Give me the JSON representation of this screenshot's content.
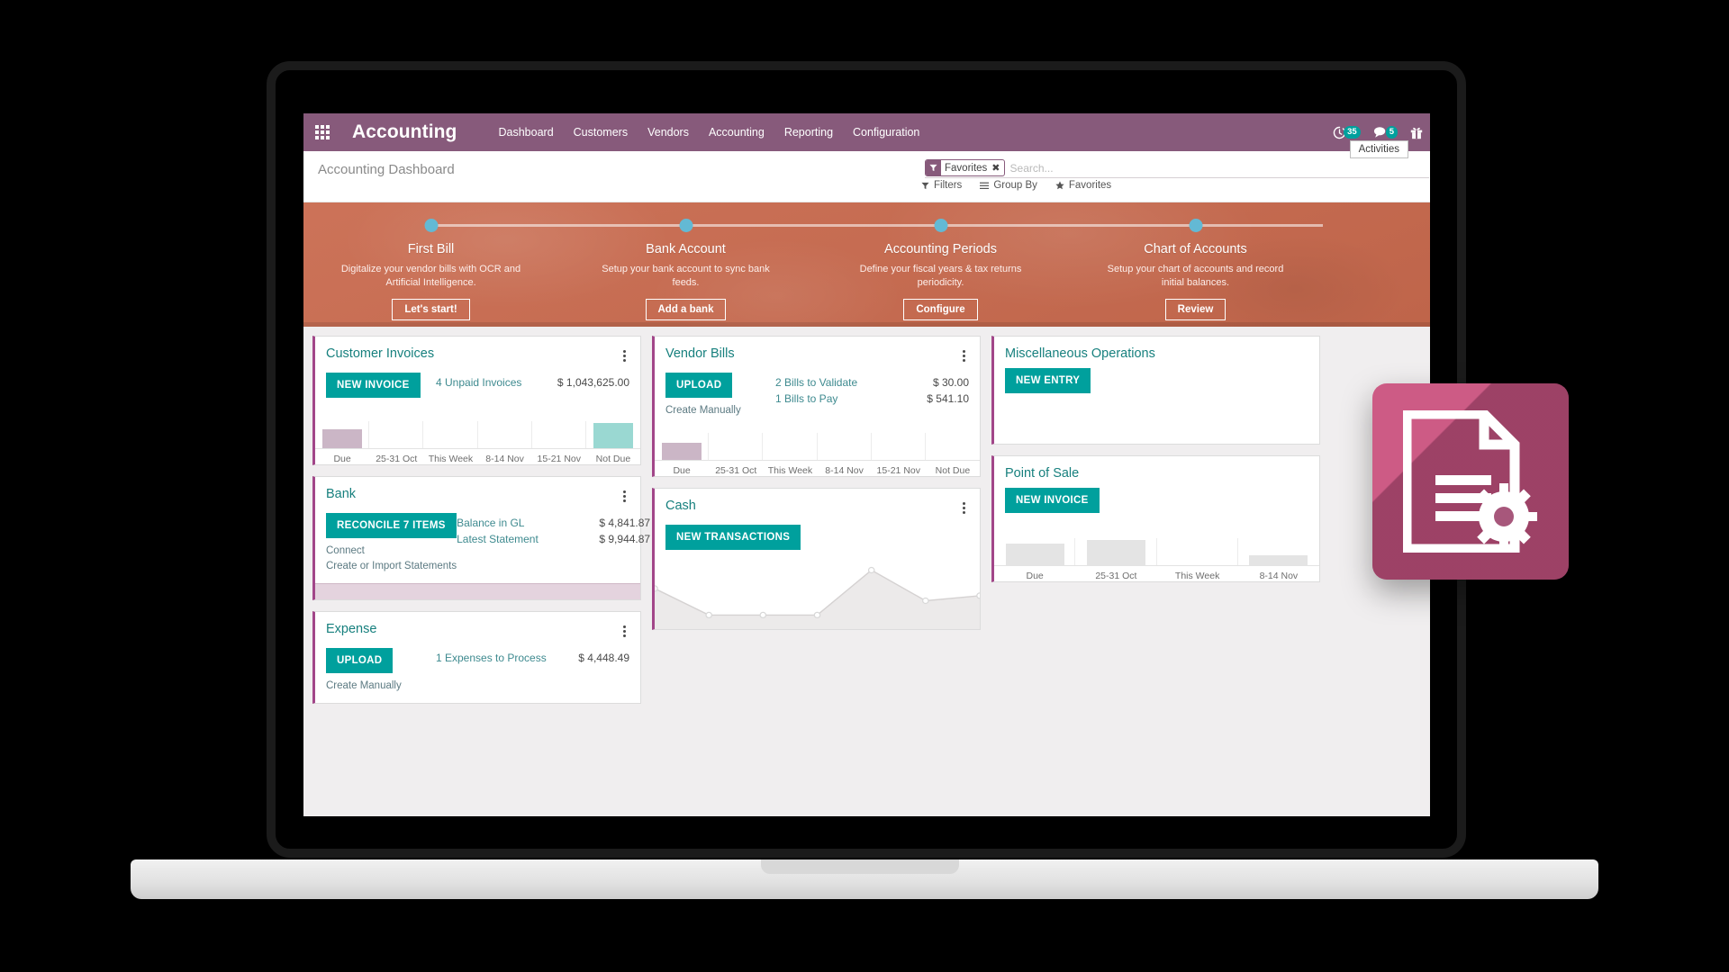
{
  "app": {
    "name": "Accounting",
    "apps_icon": "apps-grid-icon"
  },
  "navbar": {
    "menu_items": [
      {
        "label": "Dashboard"
      },
      {
        "label": "Customers"
      },
      {
        "label": "Vendors"
      },
      {
        "label": "Accounting"
      },
      {
        "label": "Reporting"
      },
      {
        "label": "Configuration"
      }
    ],
    "activities": {
      "icon": "clock-activities-icon",
      "badge": "35"
    },
    "messages": {
      "icon": "chat-messages-icon",
      "badge": "5"
    },
    "gift": {
      "icon": "gift-icon"
    },
    "tooltip": "Activities"
  },
  "control_panel": {
    "title": "Accounting Dashboard",
    "facet": {
      "icon": "filter-funnel-icon",
      "label": "Favorites",
      "remove": "✖"
    },
    "search_placeholder": "Search...",
    "search_value": "",
    "buttons": [
      {
        "label": "Filters",
        "icon": "funnel-icon"
      },
      {
        "label": "Group By",
        "icon": "list-icon"
      },
      {
        "label": "Favorites",
        "icon": "star-icon"
      }
    ]
  },
  "onboarding": {
    "accent": "#c96a4e",
    "dot_color": "#63b9d4",
    "steps": [
      {
        "title": "First Bill",
        "desc": "Digitalize your vendor bills with OCR and Artificial Intelligence.",
        "button": "Let's start!"
      },
      {
        "title": "Bank Account",
        "desc": "Setup your bank account to sync bank feeds.",
        "button": "Add a bank"
      },
      {
        "title": "Accounting Periods",
        "desc": "Define your fiscal years & tax returns periodicity.",
        "button": "Configure"
      },
      {
        "title": "Chart of Accounts",
        "desc": "Setup your chart of accounts and record initial balances.",
        "button": "Review"
      }
    ]
  },
  "dashboard": {
    "accent_teal": "#00a09d",
    "accent_purple": "#a24689",
    "customer_invoices": {
      "title": "Customer Invoices",
      "primary_button": "NEW INVOICE",
      "stats": [
        {
          "label": "4 Unpaid Invoices",
          "value": "$ 1,043,625.00"
        }
      ],
      "chart_data": {
        "type": "bar",
        "title": "Customer Invoices aging",
        "categories": [
          "Due",
          "25-31 Oct",
          "This Week",
          "8-14 Nov",
          "15-21 Nov",
          "Not Due"
        ],
        "values": [
          22,
          0,
          0,
          0,
          0,
          30
        ],
        "colors": [
          "#cbb6c6",
          "#cbb6c6",
          "#cbb6c6",
          "#cbb6c6",
          "#cbb6c6",
          "#9ad8d2"
        ],
        "xlabel": "",
        "ylabel": "",
        "ylim": [
          0,
          36
        ],
        "grid": true,
        "legend": "none"
      }
    },
    "vendor_bills": {
      "title": "Vendor Bills",
      "primary_button": "UPLOAD",
      "secondary_link": "Create Manually",
      "stats": [
        {
          "label": "2 Bills to Validate",
          "value": "$ 30.00"
        },
        {
          "label": "1 Bills to Pay",
          "value": "$ 541.10"
        }
      ],
      "chart_data": {
        "type": "bar",
        "title": "Vendor Bills aging",
        "categories": [
          "Due",
          "25-31 Oct",
          "This Week",
          "8-14 Nov",
          "15-21 Nov",
          "Not Due"
        ],
        "values": [
          20,
          0,
          0,
          0,
          0,
          0
        ],
        "colors": [
          "#cbb6c6",
          "#cbb6c6",
          "#cbb6c6",
          "#cbb6c6",
          "#cbb6c6",
          "#cbb6c6"
        ],
        "xlabel": "",
        "ylabel": "",
        "ylim": [
          0,
          36
        ],
        "grid": true,
        "legend": "none"
      }
    },
    "misc_operations": {
      "title": "Miscellaneous Operations",
      "primary_button": "NEW ENTRY"
    },
    "bank": {
      "title": "Bank",
      "primary_button": "RECONCILE 7 ITEMS",
      "links": [
        "Connect",
        "Create or Import Statements"
      ],
      "stats": [
        {
          "label": "Balance in GL",
          "value": "$ 4,841.87"
        },
        {
          "label": "Latest Statement",
          "value": "$ 9,944.87"
        }
      ]
    },
    "cash": {
      "title": "Cash",
      "primary_button": "NEW TRANSACTIONS",
      "chart_data": {
        "type": "area",
        "title": "Cash balance trend",
        "x": [
          0,
          1,
          2,
          3,
          4,
          5,
          6
        ],
        "values": [
          38,
          12,
          12,
          12,
          56,
          26,
          31
        ],
        "xlabel": "",
        "ylabel": "",
        "ylim": [
          0,
          60
        ],
        "grid": false,
        "legend": "none"
      }
    },
    "point_of_sale": {
      "title": "Point of Sale",
      "primary_button": "NEW INVOICE",
      "chart_data": {
        "type": "bar",
        "title": "Point of Sale aging",
        "categories": [
          "Due",
          "25-31 Oct",
          "This Week",
          "8-14 Nov"
        ],
        "values": [
          26,
          30,
          0,
          12
        ],
        "colors": [
          "#e4e4e4",
          "#e4e4e4",
          "#e4e4e4",
          "#e4e4e4"
        ],
        "xlabel": "",
        "ylabel": "",
        "ylim": [
          0,
          36
        ],
        "grid": true,
        "legend": "none"
      }
    },
    "expense": {
      "title": "Expense",
      "primary_button": "UPLOAD",
      "secondary_link": "Create Manually",
      "stats": [
        {
          "label": "1 Expenses to Process",
          "value": "$ 4,448.49"
        }
      ]
    }
  },
  "floating_icon": {
    "name": "document-settings-icon",
    "background": "#cd5b85"
  }
}
